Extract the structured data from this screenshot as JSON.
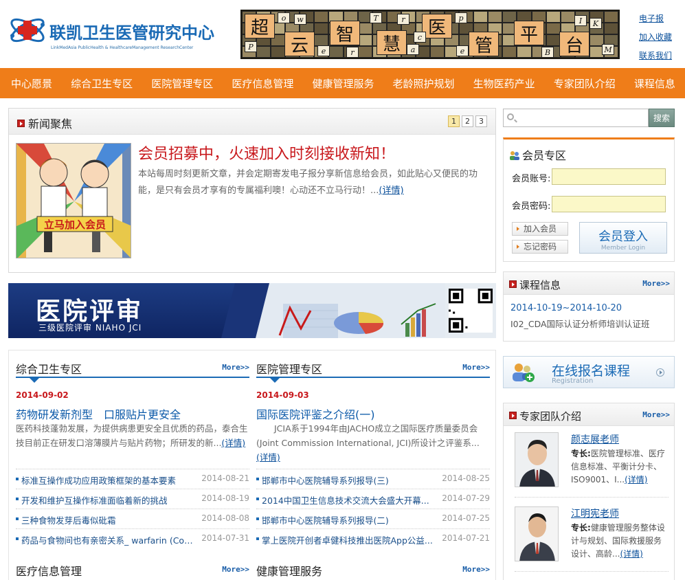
{
  "header": {
    "logo_cn": "联凯卫生医管研究中心",
    "logo_en": "LinkMedAsia PublicHealth & HealthcareManagement ResearchCenter",
    "banner": {
      "big_chars": [
        "超",
        "云",
        "智",
        "慧",
        "医",
        "管",
        "平",
        "台"
      ],
      "small_chars": [
        "o",
        "w",
        "P",
        "e",
        "r",
        "T",
        "r",
        "a",
        "c",
        "e",
        "p",
        "B",
        "I",
        "K",
        "M"
      ]
    },
    "links": [
      "电子报",
      "加入收藏",
      "联系我们"
    ]
  },
  "nav": [
    "中心愿景",
    "综合卫生专区",
    "医院管理专区",
    "医疗信息管理",
    "健康管理服务",
    "老龄照护规划",
    "生物医药产业",
    "专家团队介绍",
    "课程信息"
  ],
  "news": {
    "section_title": "新闻聚焦",
    "pages": [
      "1",
      "2",
      "3"
    ],
    "image_text": "立马加入会员",
    "headline": "会员招募中，火速加入时刻接收新知！",
    "body": "本站每周时刻更新文章，并会定期寄发电子报分享新信息给会员，如此贴心又便民的功能，是只有会员才享有的专属福利噢！心动还不立马行动！...",
    "more": "(详情)"
  },
  "hr_banner": {
    "title": "医院评审",
    "subtitle": "三级医院评审   NIAHO   JCI"
  },
  "more_label": "More>>",
  "left_col": {
    "heading": "综合卫生专区",
    "date": "2014-09-02",
    "title": "药物研发新剂型　口服贴片更安全",
    "desc": "医药科技蓬勃发展，为提供病患更安全且优质的药品，泰合生技目前正在研发口溶薄膜片与贴片药物；所研发的新...",
    "detail": "(详情)",
    "items": [
      {
        "t": "标准互操作成功应用政策框架的基本要素",
        "d": "2014-08-21"
      },
      {
        "t": "开发和维护互操作标准面临着新的挑战",
        "d": "2014-08-19"
      },
      {
        "t": "三种食物发芽后毒似砒霜",
        "d": "2014-08-08"
      },
      {
        "t": "药品与食物间也有亲密关系_ warfarin (Cou...",
        "d": "2014-07-31"
      }
    ],
    "next_heading": "医疗信息管理"
  },
  "right_col": {
    "heading": "医院管理专区",
    "date": "2014-09-03",
    "title": "国际医院评鉴之介绍(一)",
    "desc": "JCIA系于1994年由JACHO成立之国际医疗质量委员会(Joint Commission International, JCI)所设计之评鉴系...",
    "detail": "(详情)",
    "items": [
      {
        "t": "邯郸市中心医院辅导系列报导(三)",
        "d": "2014-08-25"
      },
      {
        "t": "2014中国卫生信息技术交流大会盛大开幕...",
        "d": "2014-07-29"
      },
      {
        "t": "邯郸市中心医院辅导系列报导(二)",
        "d": "2014-07-25"
      },
      {
        "t": "掌上医院开创者卓健科技推出医院App公益...",
        "d": "2014-07-21"
      }
    ],
    "next_heading": "健康管理服务"
  },
  "search": {
    "button": "搜索",
    "placeholder": ""
  },
  "member": {
    "title": "会员专区",
    "account_label": "会员账号:",
    "password_label": "会员密码:",
    "join": "加入会员",
    "forgot": "忘记密码",
    "login": "会员登入",
    "login_en": "Member Login"
  },
  "course": {
    "title": "课程信息",
    "date": "2014-10-19~2014-10-20",
    "name": "I02_CDA国际认证分析师培训认证班"
  },
  "register": {
    "title": "在线报名课程",
    "en": "Registration"
  },
  "experts": {
    "title": "专家团队介绍",
    "label": "专长:",
    "detail": "(详情)",
    "list": [
      {
        "name": "颜志展老师",
        "desc": "医院管理标准、医疗信息标准、平衡计分卡、ISO9001、I..."
      },
      {
        "name": "江明宪老师",
        "desc": "健康管理服务整体设计与规划、国际救援服务设计、高龄..."
      }
    ]
  },
  "colors": {
    "nav": "#ef7d19",
    "headline": "#c8181c",
    "link": "#0a58a8"
  }
}
